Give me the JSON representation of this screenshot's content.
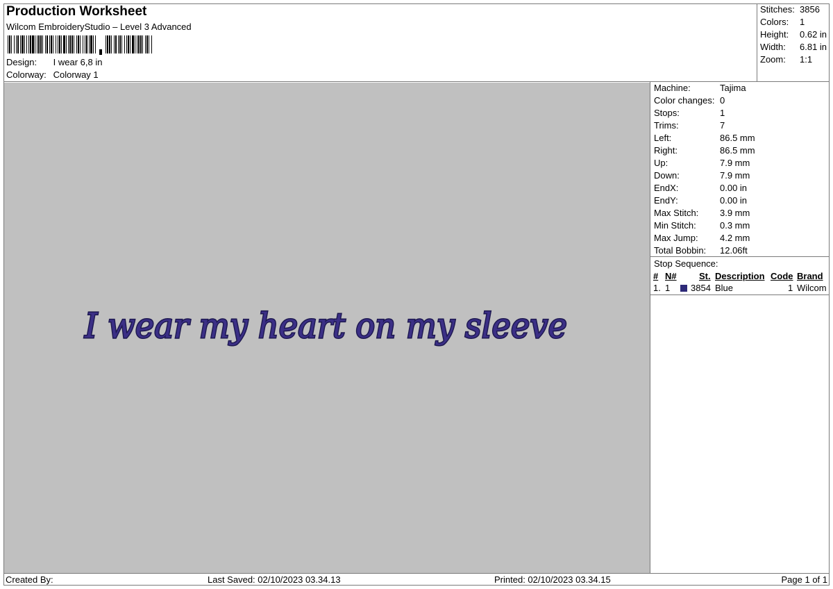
{
  "header": {
    "title": "Production Worksheet",
    "subtitle": "Wilcom EmbroideryStudio – Level 3 Advanced",
    "design_label": "Design:",
    "design_value": "I wear 6,8 in",
    "colorway_label": "Colorway:",
    "colorway_value": "Colorway 1"
  },
  "summary": [
    {
      "label": "Stitches:",
      "value": "3856"
    },
    {
      "label": "Colors:",
      "value": "1"
    },
    {
      "label": "Height:",
      "value": "0.62 in"
    },
    {
      "label": "Width:",
      "value": "6.81 in"
    },
    {
      "label": "Zoom:",
      "value": "1:1"
    }
  ],
  "design_preview": {
    "text": "I wear my heart on my sleeve",
    "thread_color": "#3b2f86",
    "background_color": "#c0c0c0"
  },
  "properties": [
    {
      "label": "Machine:",
      "value": "Tajima"
    },
    {
      "label": "Color changes:",
      "value": "0"
    },
    {
      "label": "Stops:",
      "value": "1"
    },
    {
      "label": "Trims:",
      "value": "7"
    },
    {
      "label": "Left:",
      "value": "86.5 mm"
    },
    {
      "label": "Right:",
      "value": "86.5 mm"
    },
    {
      "label": "Up:",
      "value": "7.9 mm"
    },
    {
      "label": "Down:",
      "value": "7.9 mm"
    },
    {
      "label": "EndX:",
      "value": "0.00 in"
    },
    {
      "label": "EndY:",
      "value": "0.00 in"
    },
    {
      "label": "Max Stitch:",
      "value": "3.9 mm"
    },
    {
      "label": "Min Stitch:",
      "value": "0.3 mm"
    },
    {
      "label": "Max Jump:",
      "value": "4.2 mm"
    },
    {
      "label": "Total Bobbin:",
      "value": "12.06ft"
    }
  ],
  "stop_sequence": {
    "title": "Stop Sequence:",
    "columns": {
      "index": "#",
      "needle": "N#",
      "stitches": "St.",
      "description": "Description",
      "code": "Code",
      "brand": "Brand"
    },
    "rows": [
      {
        "index": "1.",
        "needle": "1",
        "color": "#2e2a78",
        "stitches": "3854",
        "description": "Blue",
        "code": "1",
        "brand": "Wilcom"
      }
    ]
  },
  "footer": {
    "created_by": "Created By:",
    "last_saved": "Last Saved: 02/10/2023 03.34.13",
    "printed": "Printed: 02/10/2023 03.34.15",
    "page": "Page 1 of 1"
  }
}
